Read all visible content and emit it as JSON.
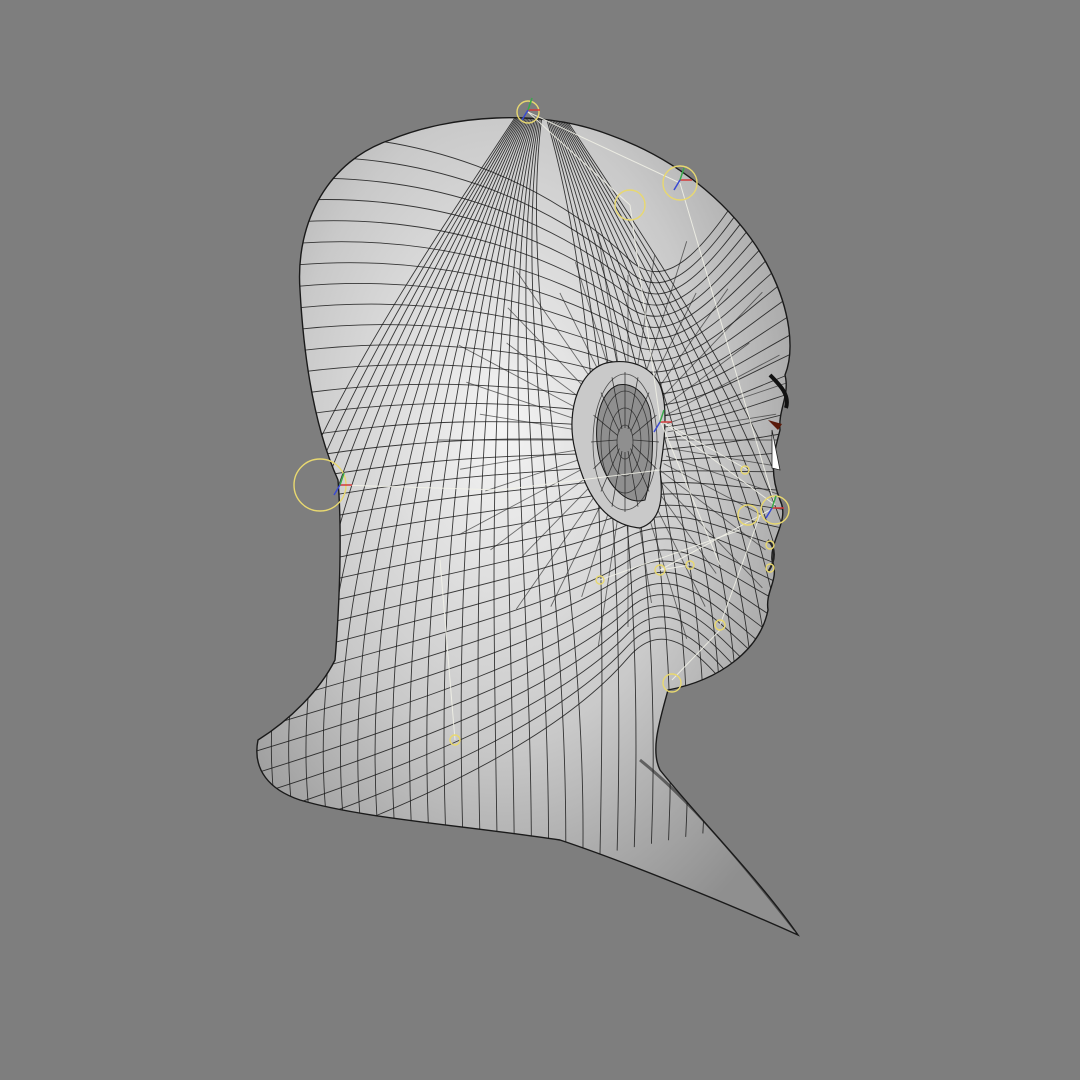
{
  "viewport": {
    "background_color": "#7e7e7e",
    "mesh_fill_light": "#f4f4f4",
    "mesh_fill_mid": "#c9c9c9",
    "mesh_fill_dark": "#8f8f8f",
    "wire_color": "#1a1a1a",
    "rig_control_color": "#e8d870",
    "rig_line_color": "#f2f2e8",
    "axis_x_color": "#d23a3a",
    "axis_y_color": "#3aa84a",
    "axis_z_color": "#3a4ad2"
  },
  "subject": {
    "object": "head-mesh",
    "view": "rear-three-quarter",
    "display_mode": "wireframe-on-shaded",
    "rig_controls_visible": true
  }
}
